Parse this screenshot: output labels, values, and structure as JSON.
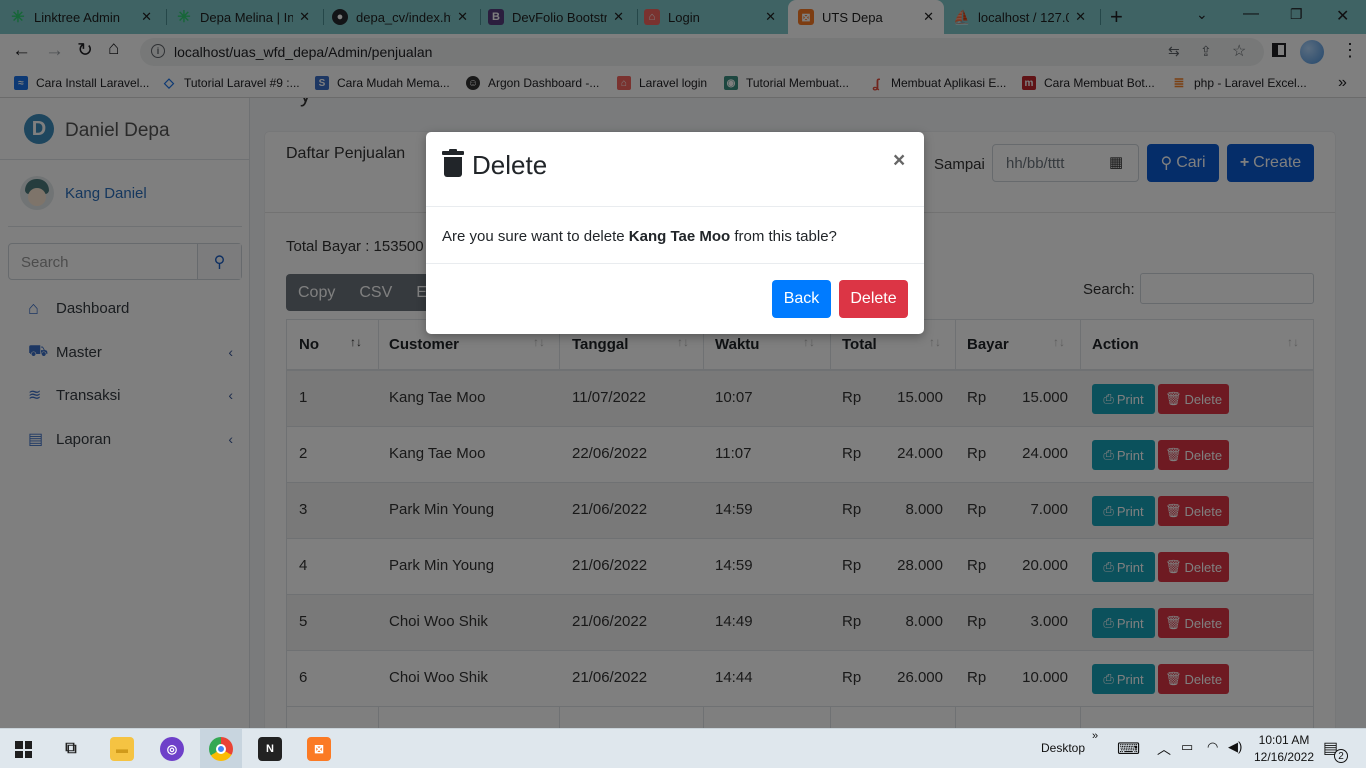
{
  "browser": {
    "tabs": [
      {
        "title": "Linktree Admin"
      },
      {
        "title": "Depa Melina | Ins"
      },
      {
        "title": "depa_cv/index.ht"
      },
      {
        "title": "DevFolio Bootstr"
      },
      {
        "title": "Login"
      },
      {
        "title": "UTS Depa"
      },
      {
        "title": "localhost / 127.0"
      }
    ],
    "new_tab": "+",
    "url": "localhost/uas_wfd_depa/Admin/penjualan",
    "bookmarks": [
      {
        "label": "Cara Install Laravel..."
      },
      {
        "label": "Tutorial Laravel #9 :..."
      },
      {
        "label": "Cara Mudah Mema..."
      },
      {
        "label": "Argon Dashboard -..."
      },
      {
        "label": "Laravel login"
      },
      {
        "label": "Tutorial Membuat..."
      },
      {
        "label": "Membuat Aplikasi E..."
      },
      {
        "label": "Cara Membuat Bot..."
      },
      {
        "label": "php - Laravel Excel..."
      }
    ]
  },
  "sidebar": {
    "brand": "Daniel Depa",
    "brand_logo": "D",
    "user_name": "Kang Daniel",
    "search_placeholder": "Search",
    "nav": [
      {
        "label": "Dashboard"
      },
      {
        "label": "Master"
      },
      {
        "label": "Transaksi"
      },
      {
        "label": "Laporan"
      }
    ]
  },
  "content": {
    "card_title": "Daftar Penjualan",
    "sampai_label": "Sampai",
    "date_placeholder": "hh/bb/tttt",
    "cari_label": "Cari",
    "create_label": "Create",
    "total_bayar": "Total Bayar : 153500",
    "export_buttons": [
      "Copy",
      "CSV",
      "Excel"
    ],
    "search_label": "Search:",
    "columns": [
      "No",
      "Customer",
      "Tanggal",
      "Waktu",
      "Total",
      "Bayar",
      "Action"
    ],
    "currency": "Rp",
    "print_label": "Print",
    "delete_label": "Delete",
    "rows": [
      {
        "no": "1",
        "customer": "Kang Tae Moo",
        "tanggal": "11/07/2022",
        "waktu": "10:07",
        "total": "15.000",
        "bayar": "15.000"
      },
      {
        "no": "2",
        "customer": "Kang Tae Moo",
        "tanggal": "22/06/2022",
        "waktu": "11:07",
        "total": "24.000",
        "bayar": "24.000"
      },
      {
        "no": "3",
        "customer": "Park Min Young",
        "tanggal": "21/06/2022",
        "waktu": "14:59",
        "total": "8.000",
        "bayar": "7.000"
      },
      {
        "no": "4",
        "customer": "Park Min Young",
        "tanggal": "21/06/2022",
        "waktu": "14:59",
        "total": "28.000",
        "bayar": "20.000"
      },
      {
        "no": "5",
        "customer": "Choi Woo Shik",
        "tanggal": "21/06/2022",
        "waktu": "14:49",
        "total": "8.000",
        "bayar": "3.000"
      },
      {
        "no": "6",
        "customer": "Choi Woo Shik",
        "tanggal": "21/06/2022",
        "waktu": "14:44",
        "total": "26.000",
        "bayar": "10.000"
      }
    ]
  },
  "modal": {
    "title": "Delete",
    "close": "×",
    "message_prefix": "Are you sure want to delete ",
    "message_name": "Kang Tae Moo",
    "message_suffix": " from this table?",
    "back_label": "Back",
    "delete_label": "Delete"
  },
  "taskbar": {
    "desktop_label": "Desktop",
    "time": "10:01 AM",
    "date": "12/16/2022",
    "notification_count": "2"
  },
  "colors": {
    "primary": "#007bff",
    "danger": "#dc3545",
    "info": "#17a2b8",
    "dark_primary": "#0d5fd6",
    "chrome_tab": "#7fc7c9"
  }
}
